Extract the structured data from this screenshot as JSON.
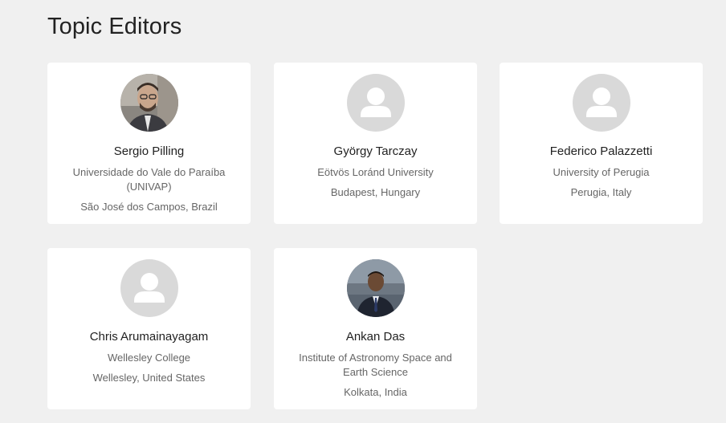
{
  "section": {
    "title": "Topic Editors"
  },
  "editors": [
    {
      "name": "Sergio Pilling",
      "affiliation": "Universidade do Vale do Paraíba (UNIVAP)",
      "location": "São José dos Campos, Brazil",
      "avatar": "photo"
    },
    {
      "name": "György Tarczay",
      "affiliation": "Eötvös Loránd University",
      "location": "Budapest, Hungary",
      "avatar": "placeholder-user-icon"
    },
    {
      "name": "Federico Palazzetti",
      "affiliation": "University of Perugia",
      "location": "Perugia, Italy",
      "avatar": "placeholder-user-icon"
    },
    {
      "name": "Chris Arumainayagam",
      "affiliation": "Wellesley College",
      "location": "Wellesley, United States",
      "avatar": "placeholder-user-icon"
    },
    {
      "name": "Ankan Das",
      "affiliation": "Institute of Astronomy Space and Earth Science",
      "location": "Kolkata, India",
      "avatar": "photo"
    }
  ],
  "colors": {
    "background": "#f0f0f0",
    "card": "#ffffff",
    "name_text": "#222222",
    "meta_text": "#666666",
    "placeholder_bg": "#d9d9d9"
  }
}
